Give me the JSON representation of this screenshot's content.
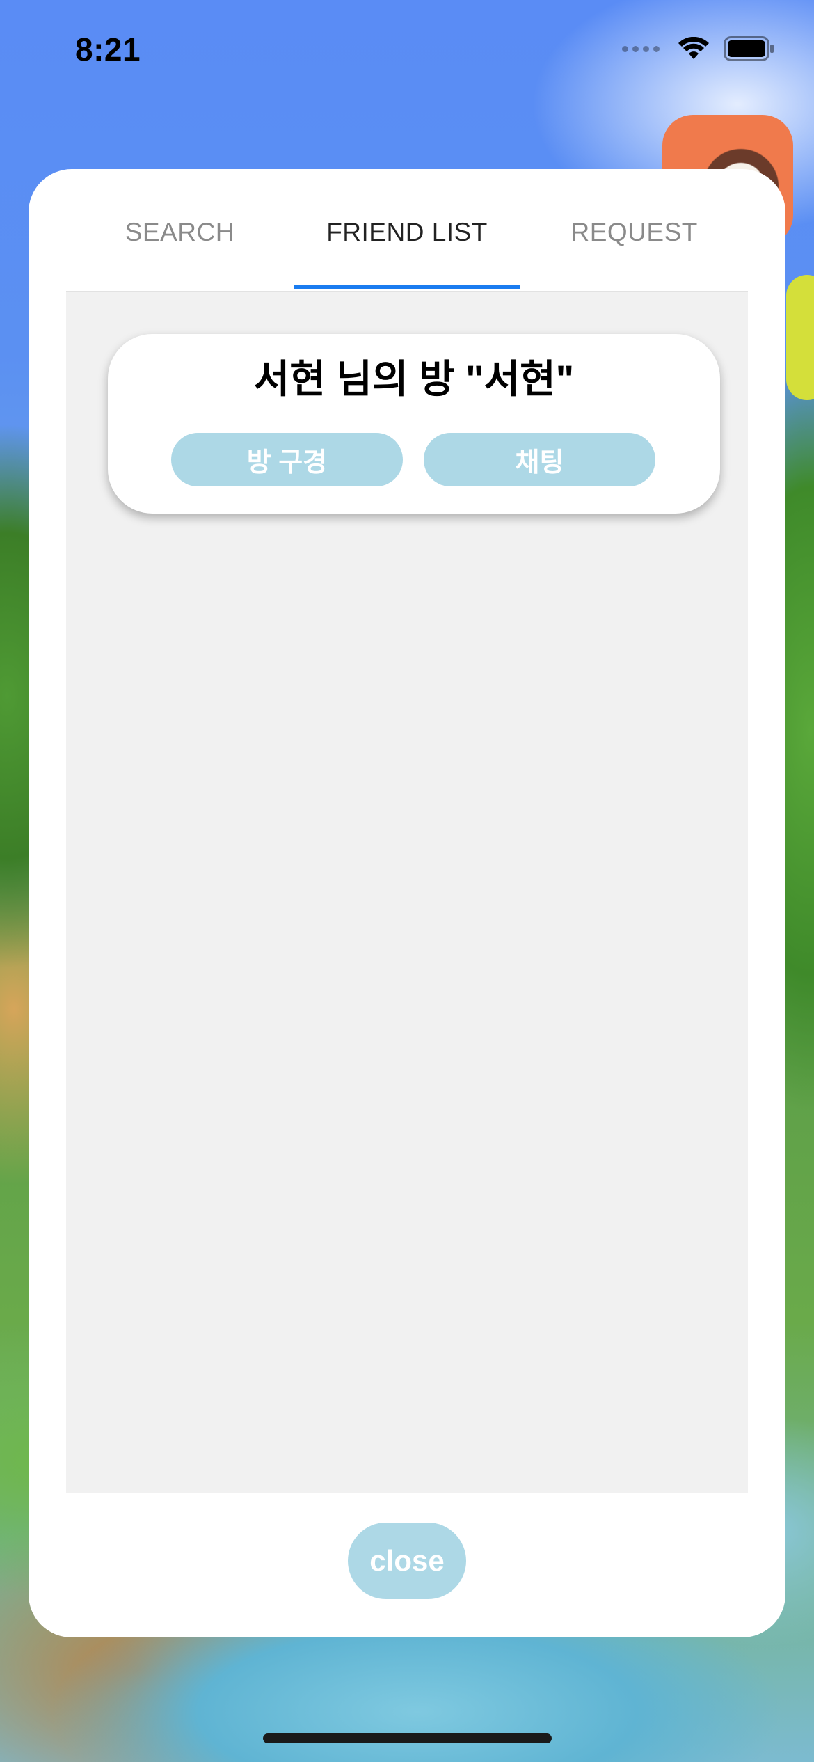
{
  "status_bar": {
    "time": "8:21"
  },
  "tabs": [
    {
      "label": "SEARCH",
      "active": false
    },
    {
      "label": "FRIEND LIST",
      "active": true
    },
    {
      "label": "REQUEST",
      "active": false
    }
  ],
  "friends": [
    {
      "title": "서현 님의 방 \"서현\"",
      "visit_label": "방 구경",
      "chat_label": "채팅"
    }
  ],
  "close_label": "close",
  "colors": {
    "accent": "#1a7cf0",
    "button": "#add8e6",
    "list_bg": "#f1f1f1"
  },
  "icons": [
    "wifi-icon",
    "battery-icon",
    "cellular-signal-icon"
  ]
}
